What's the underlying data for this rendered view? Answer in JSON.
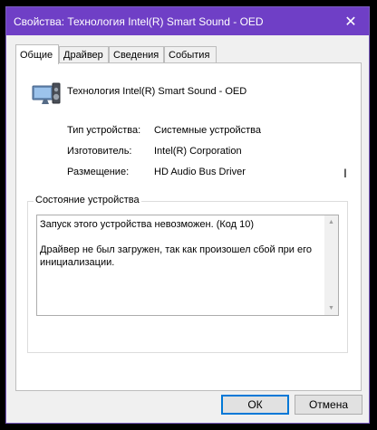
{
  "window": {
    "title": "Свойства: Технология Intel(R) Smart Sound - OED",
    "close_glyph": "✕"
  },
  "tabs": [
    {
      "label": "Общие",
      "active": true
    },
    {
      "label": "Драйвер",
      "active": false
    },
    {
      "label": "Сведения",
      "active": false
    },
    {
      "label": "События",
      "active": false
    }
  ],
  "device": {
    "name": "Технология Intel(R) Smart Sound - OED",
    "icon": "audio-device-icon"
  },
  "properties": [
    {
      "label": "Тип устройства:",
      "value": "Системные устройства"
    },
    {
      "label": "Изготовитель:",
      "value": "Intel(R) Corporation"
    },
    {
      "label": "Размещение:",
      "value": "HD Audio Bus Driver"
    }
  ],
  "status": {
    "group_label": "Состояние устройства",
    "line1": "Запуск этого устройства невозможен. (Код 10)",
    "line2": "Драйвер не был загружен, так как произошел сбой при его инициализации."
  },
  "cursor": {
    "glyph": "I"
  },
  "buttons": {
    "ok": "ОК",
    "cancel": "Отмена"
  },
  "colors": {
    "titlebar": "#6f3fc6",
    "default_button_border": "#0078d7"
  }
}
